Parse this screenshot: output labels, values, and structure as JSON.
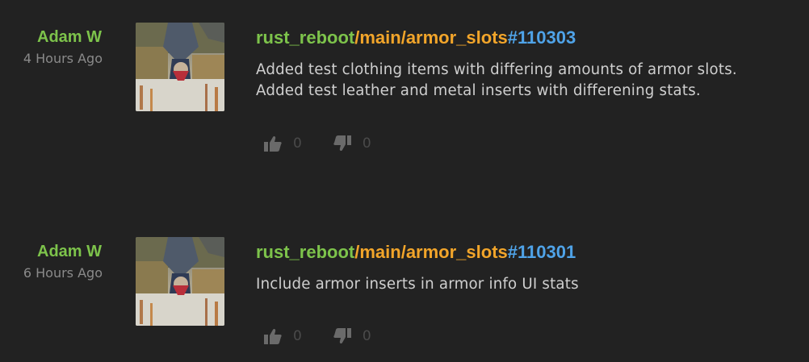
{
  "commits": [
    {
      "author": "Adam W",
      "time": "4 Hours Ago",
      "repo": "rust_reboot",
      "branch": "/main/armor_slots",
      "changeset": "#110303",
      "message": "Added test clothing items with differing amounts of armor slots.\nAdded test leather and metal inserts with differening stats.",
      "likes": "0",
      "dislikes": "0"
    },
    {
      "author": "Adam W",
      "time": "6 Hours Ago",
      "repo": "rust_reboot",
      "branch": "/main/armor_slots",
      "changeset": "#110301",
      "message": "Include armor inserts in armor info UI stats",
      "likes": "0",
      "dislikes": "0"
    }
  ],
  "icons": {
    "like": "thumbs-up-icon",
    "dislike": "thumbs-down-icon"
  },
  "colors": {
    "background": "#222222",
    "author": "#7dc34b",
    "repo": "#7dc34b",
    "branch": "#f2a52a",
    "changeset": "#4fa3e8",
    "time": "#8a8a8a",
    "vote_icon": "#6a6a6a"
  }
}
